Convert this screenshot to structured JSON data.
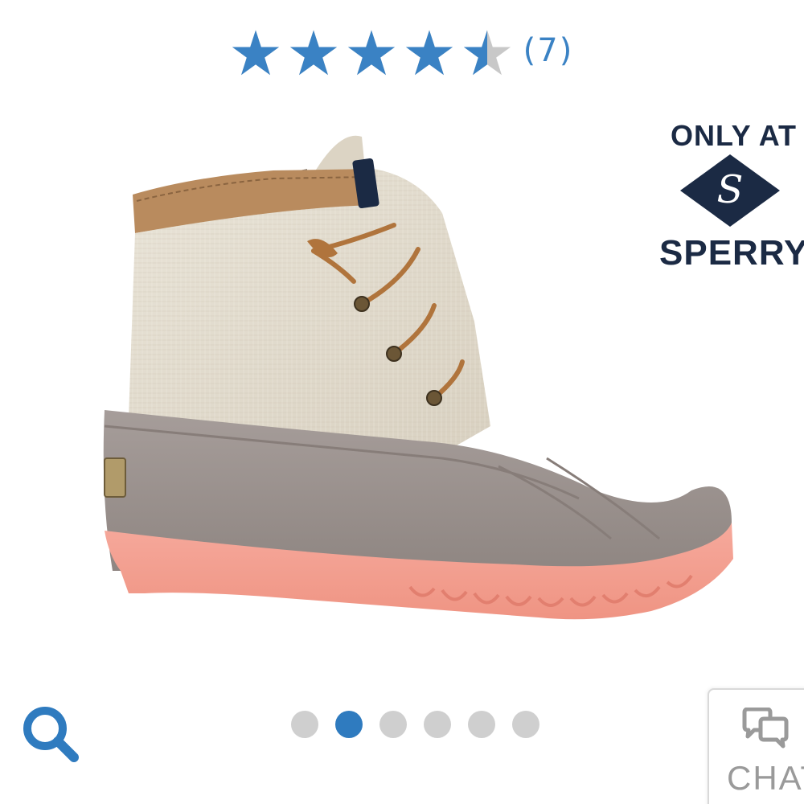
{
  "rating": {
    "value": 4.5,
    "max": 5,
    "count_text": "(7)"
  },
  "badge": {
    "top_text": "ONLY AT",
    "bottom_text": "SPERRY",
    "mark_letter": "S"
  },
  "product": {
    "image_icon": "duck-boot-product-image"
  },
  "carousel": {
    "total": 6,
    "active_index": 1
  },
  "chat": {
    "label": "CHAT"
  },
  "search": {
    "icon": "search-icon"
  },
  "colors": {
    "star_blue": "#3a82c4",
    "star_empty": "#c8c8c8",
    "count_text": "#3a82c4",
    "brand_navy": "#1b2a44",
    "dot_inactive": "#cfcfcf",
    "dot_active": "#2f7bbf",
    "search_icon": "#2f7bbf",
    "chat_icon": "#9a9a9a",
    "chat_text": "#9a9a9a"
  }
}
